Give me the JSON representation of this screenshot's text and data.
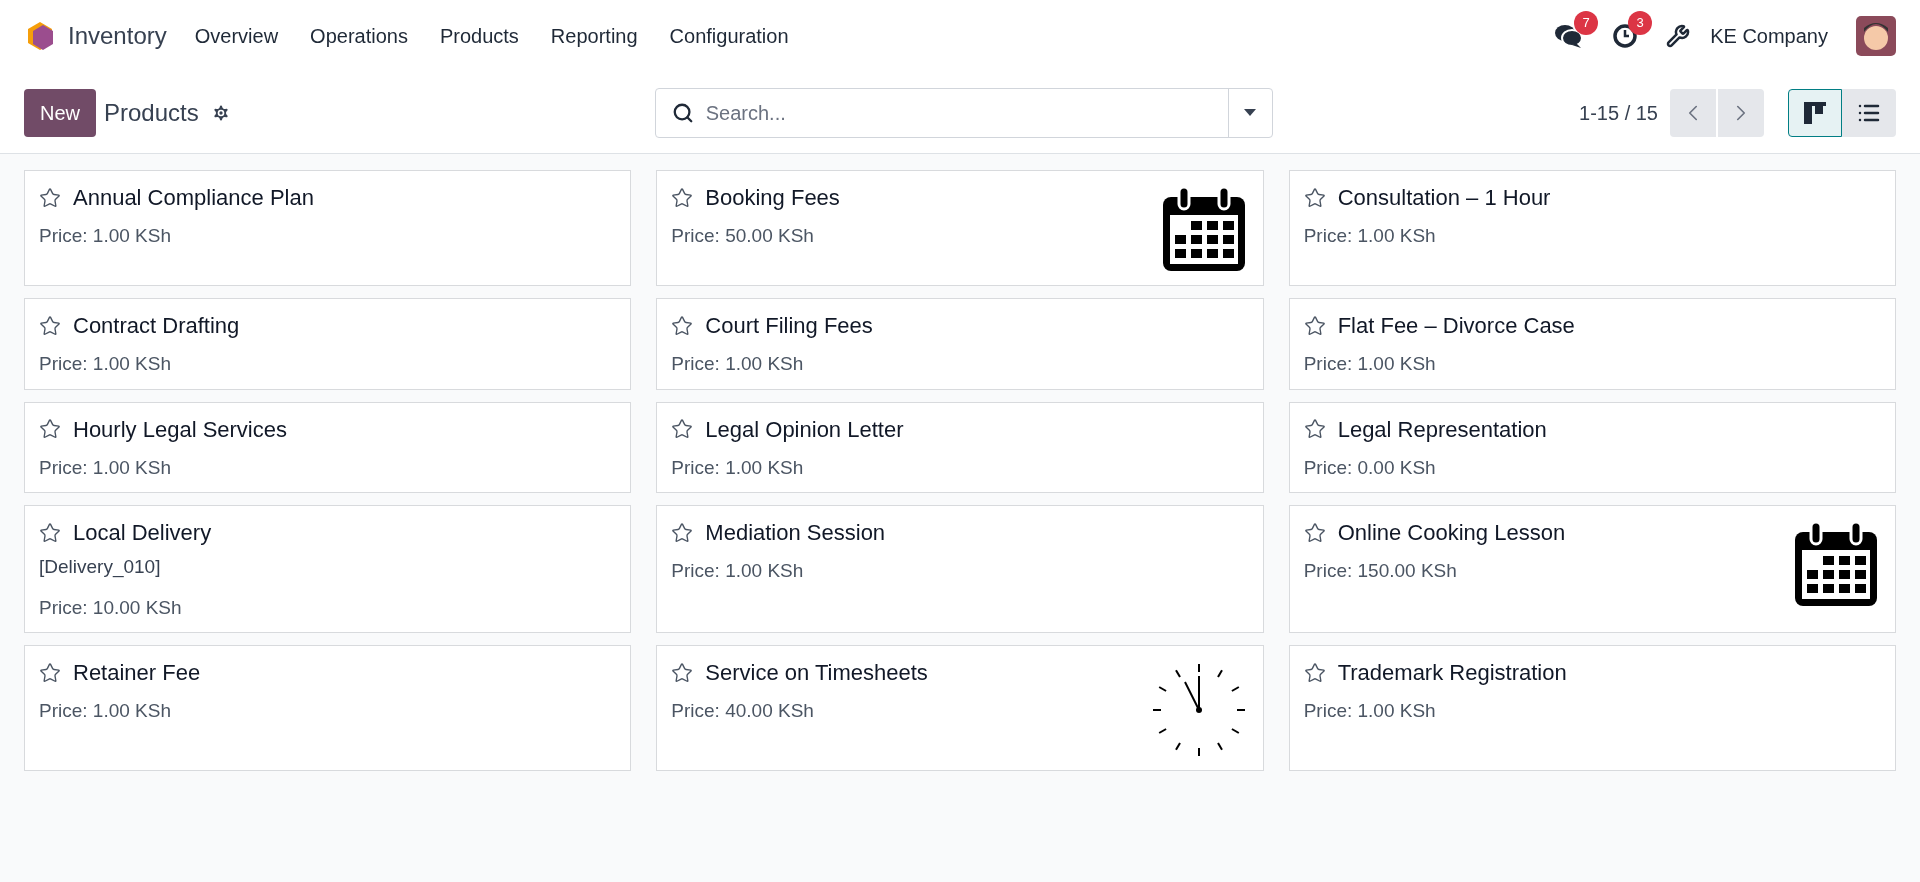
{
  "navbar": {
    "app_name": "Inventory",
    "menu": [
      "Overview",
      "Operations",
      "Products",
      "Reporting",
      "Configuration"
    ],
    "messages_count": "7",
    "activities_count": "3",
    "company": "KE Company"
  },
  "control_panel": {
    "new_button": "New",
    "title": "Products",
    "search": {
      "placeholder": "Search..."
    },
    "pager": "1-15 / 15",
    "views": [
      {
        "kind": "kanban",
        "selected": true
      },
      {
        "kind": "list",
        "selected": false
      }
    ]
  },
  "products": [
    {
      "name": "Annual Compliance Plan",
      "price": "Price: 1.00 KSh",
      "starred": false
    },
    {
      "name": "Booking Fees",
      "price": "Price: 50.00 KSh",
      "starred": false,
      "kind": "calendar"
    },
    {
      "name": "Consultation – 1 Hour",
      "price": "Price: 1.00 KSh",
      "starred": false
    },
    {
      "name": "Contract Drafting",
      "price": "Price: 1.00 KSh",
      "starred": false
    },
    {
      "name": "Court Filing Fees",
      "price": "Price: 1.00 KSh",
      "starred": false
    },
    {
      "name": "Flat Fee – Divorce Case",
      "price": "Price: 1.00 KSh",
      "starred": false
    },
    {
      "name": "Hourly Legal Services",
      "price": "Price: 1.00 KSh",
      "starred": false
    },
    {
      "name": "Legal Opinion Letter",
      "price": "Price: 1.00 KSh",
      "starred": false
    },
    {
      "name": "Legal Representation",
      "price": "Price: 0.00 KSh",
      "starred": false
    },
    {
      "name": "Local Delivery",
      "reference": "[Delivery_010]",
      "price": "Price: 10.00 KSh",
      "starred": false
    },
    {
      "name": "Mediation Session",
      "price": "Price: 1.00 KSh",
      "starred": false
    },
    {
      "name": "Online Cooking Lesson",
      "price": "Price: 150.00 KSh",
      "starred": false,
      "kind": "calendar"
    },
    {
      "name": "Retainer Fee",
      "price": "Price: 1.00 KSh",
      "starred": false
    },
    {
      "name": "Service on Timesheets",
      "price": "Price: 40.00 KSh",
      "starred": false,
      "kind": "clock"
    },
    {
      "name": "Trademark Registration",
      "price": "Price: 1.00 KSh",
      "starred": false
    }
  ]
}
